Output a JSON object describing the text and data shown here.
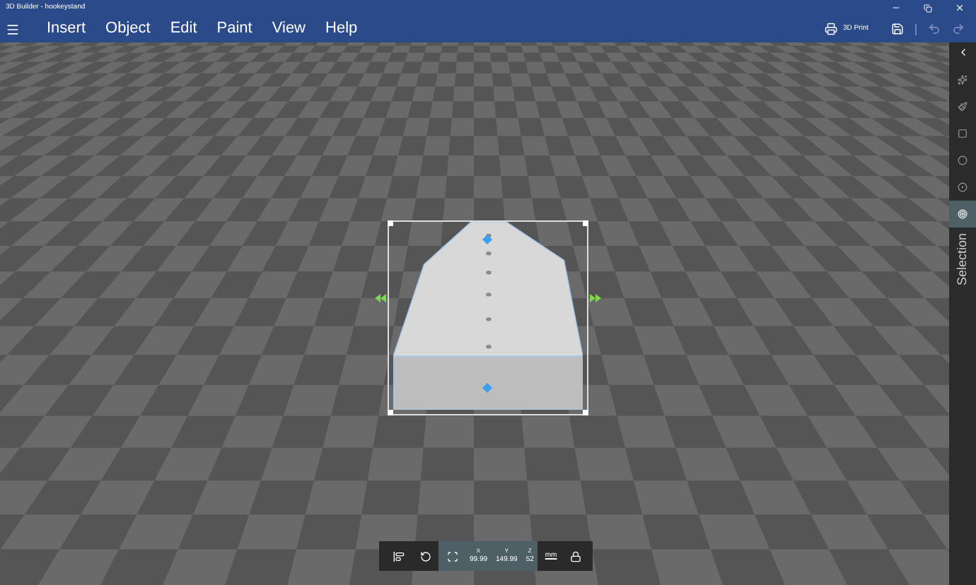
{
  "window": {
    "title": "3D Builder - hookeystand"
  },
  "menu": [
    {
      "label": "Insert"
    },
    {
      "label": "Object"
    },
    {
      "label": "Edit"
    },
    {
      "label": "Paint"
    },
    {
      "label": "View"
    },
    {
      "label": "Help"
    }
  ],
  "toolbar": {
    "print_label": "3D Print"
  },
  "sidebar": {
    "tools": [
      {
        "kind": "sparkle",
        "selected": false
      },
      {
        "kind": "brush",
        "selected": false
      },
      {
        "kind": "square",
        "selected": false
      },
      {
        "kind": "circle",
        "selected": false
      },
      {
        "kind": "sphere",
        "selected": false
      },
      {
        "kind": "target",
        "selected": true
      }
    ],
    "panel_label": "Selection"
  },
  "transform_bar": {
    "modes": [
      {
        "kind": "align",
        "selected": false
      },
      {
        "kind": "rotate",
        "selected": false
      },
      {
        "kind": "scale",
        "selected": true
      }
    ],
    "fields": [
      {
        "axis": "X",
        "value": "99.99"
      },
      {
        "axis": "Y",
        "value": "149.99"
      },
      {
        "axis": "Z",
        "value": "52"
      }
    ],
    "unit": "mm"
  }
}
